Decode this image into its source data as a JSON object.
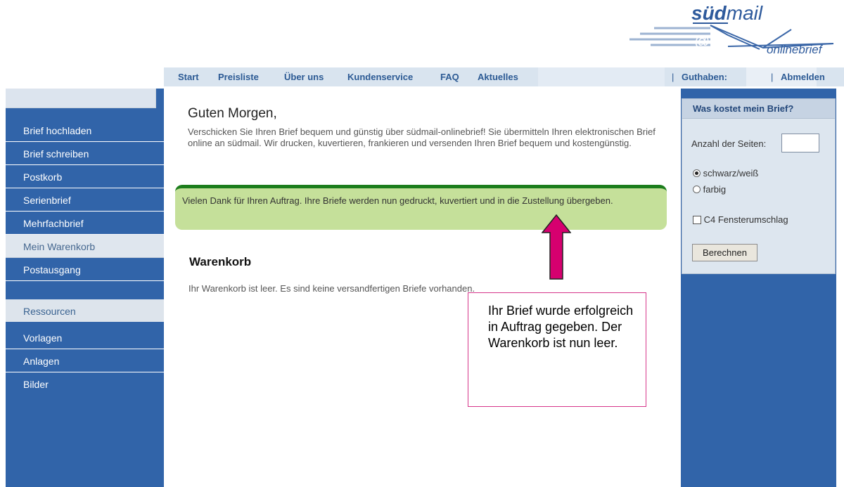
{
  "logo": {
    "brand_bold": "süd",
    "brand_rest": "mail",
    "tagline": "onlinebrief",
    "at_symbol": "@"
  },
  "topnav": {
    "items": [
      "Start",
      "Preisliste",
      "Über uns",
      "Kundenservice",
      "FAQ",
      "Aktuelles"
    ],
    "credit_label": "Guthaben: ",
    "credit_value": "",
    "logout": "Abmelden",
    "separator": "|"
  },
  "sidebar": {
    "items": [
      "Brief hochladen",
      "Brief schreiben",
      "Postkorb",
      "Serienbrief",
      "Mehrfachbrief",
      "Mein Warenkorb",
      "Postausgang"
    ],
    "active_item": "Mein Warenkorb",
    "resources_header": "Ressourcen",
    "resources": [
      "Vorlagen",
      "Anlagen",
      "Bilder"
    ]
  },
  "main": {
    "greeting": "Guten Morgen,",
    "intro": "Verschicken Sie Ihren Brief bequem und günstig über südmail-onlinebrief! Sie übermitteln Ihren elektronischen Brief online an südmail. Wir drucken, kuvertieren, frankieren und versenden Ihren Brief bequem und kostengünstig.",
    "notice": "Vielen Dank für Ihren Auftrag. Ihre Briefe werden nun gedruckt, kuvertiert und in die Zustellung übergeben.",
    "cart_title": "Warenkorb",
    "cart_empty": "Ihr Warenkorb ist leer. Es sind keine versandfertigen Briefe vorhanden."
  },
  "annotation": {
    "text": "Ihr Brief wurde erfolgreich in Auftrag gegeben. Der Warenkorb ist nun leer.",
    "color": "#d6006f"
  },
  "calculator": {
    "title": "Was kostet mein Brief?",
    "pages_label": "Anzahl der Seiten:",
    "pages_value": "",
    "color_options": [
      "schwarz/weiß",
      "farbig"
    ],
    "selected_color": "schwarz/weiß",
    "envelope_label": "C4 Fensterumschlag",
    "envelope_checked": false,
    "button": "Berechnen"
  },
  "colors": {
    "nav_blue": "#3164a9",
    "link_blue": "#2c5a94",
    "notice_green": "#c5e09a",
    "notice_border": "#1c7d1c"
  }
}
